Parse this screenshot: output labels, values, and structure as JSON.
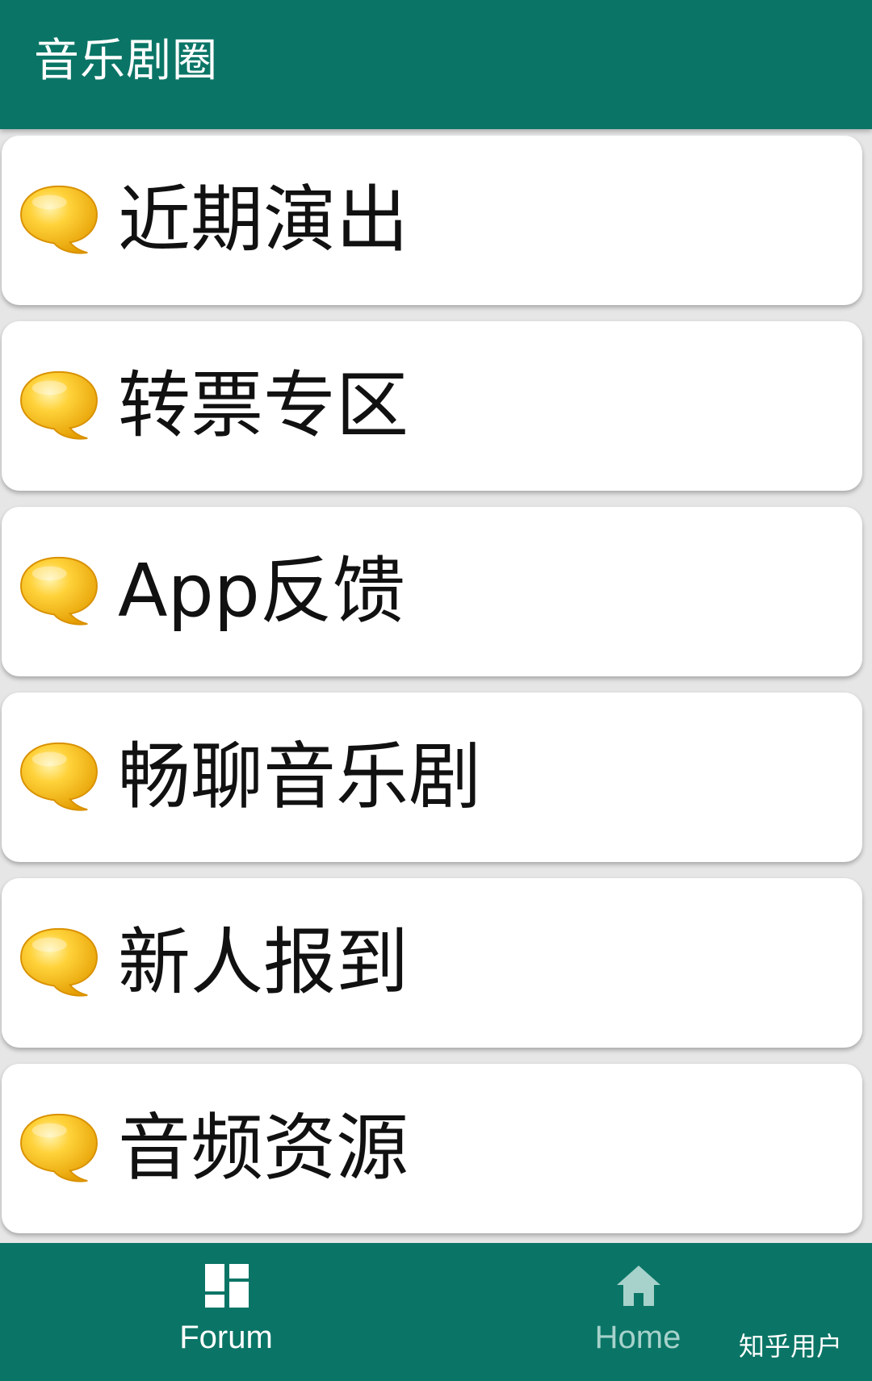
{
  "app_bar": {
    "title": "音乐剧圈",
    "background_color": "#0a7566"
  },
  "forums": [
    {
      "label": "近期演出",
      "icon": "speech-bubble-icon"
    },
    {
      "label": "转票专区",
      "icon": "speech-bubble-icon"
    },
    {
      "label": "App反馈",
      "icon": "speech-bubble-icon"
    },
    {
      "label": "畅聊音乐剧",
      "icon": "speech-bubble-icon"
    },
    {
      "label": "新人报到",
      "icon": "speech-bubble-icon"
    },
    {
      "label": "音频资源",
      "icon": "speech-bubble-icon"
    }
  ],
  "bottom_nav": {
    "items": [
      {
        "label": "Forum",
        "icon": "dashboard-grid-icon",
        "active": true
      },
      {
        "label": "Home",
        "icon": "home-icon",
        "active": false
      }
    ],
    "active_color": "#ffffff",
    "inactive_color": "#a6d2cb"
  },
  "watermark": "知乎用户",
  "colors": {
    "bubble": "#f8c21c",
    "card": "#ffffff",
    "page_background": "#e6e6e6"
  }
}
